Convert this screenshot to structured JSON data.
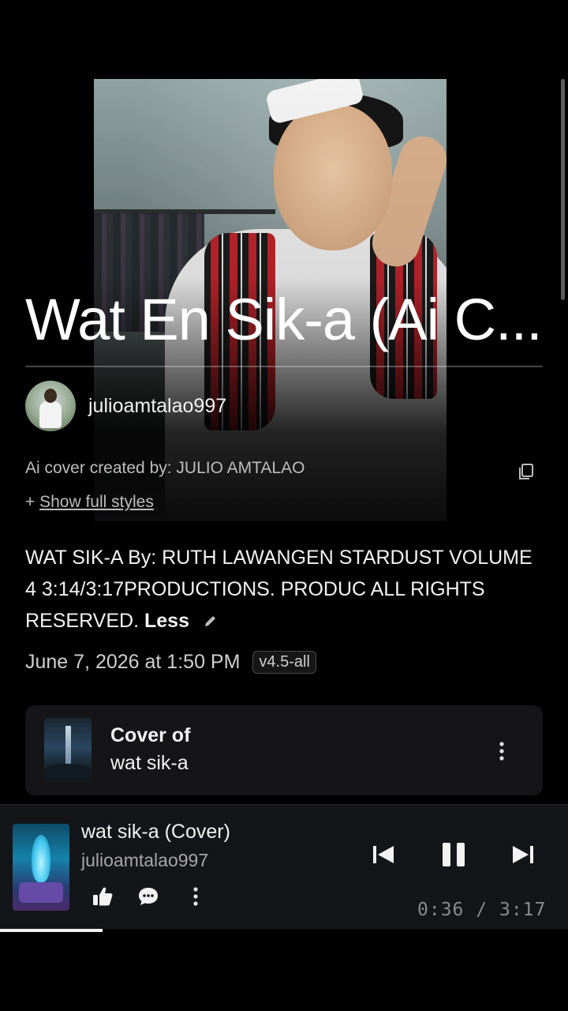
{
  "song": {
    "title": "Wat En Sik-a (Ai C...",
    "creator": "julioamtalao997",
    "description": "Ai cover created by: JULIO AMTALAO",
    "show_styles_prefix": "+ ",
    "show_styles_label": "Show full styles",
    "lyrics": "WAT SIK-A By: RUTH LAWANGEN STARDUST VOLUME 4 3:14/3:17PRODUCTIONS. PRODUC ALL RIGHTS RESERVED.",
    "less_label": "Less",
    "date": "June 7, 2026 at 1:50 PM",
    "version": "v4.5-all"
  },
  "cover_card": {
    "label": "Cover of",
    "song": "wat sik-a"
  },
  "player": {
    "title": "wat sik-a (Cover)",
    "artist": "julioamtalao997",
    "elapsed": "0:36",
    "separator": "/",
    "duration": "3:17",
    "progress_fraction": 0.18
  },
  "icons": {
    "copy": "copy-icon",
    "edit": "pencil-icon",
    "menu": "more-vertical-icon",
    "like": "thumbs-up-icon",
    "comment": "comment-icon",
    "prev": "skip-previous-icon",
    "pause": "pause-icon",
    "next": "skip-next-icon"
  },
  "colors": {
    "background": "#000000",
    "card": "#151517",
    "player": "#141519",
    "muted_text": "#bdbdbd"
  }
}
